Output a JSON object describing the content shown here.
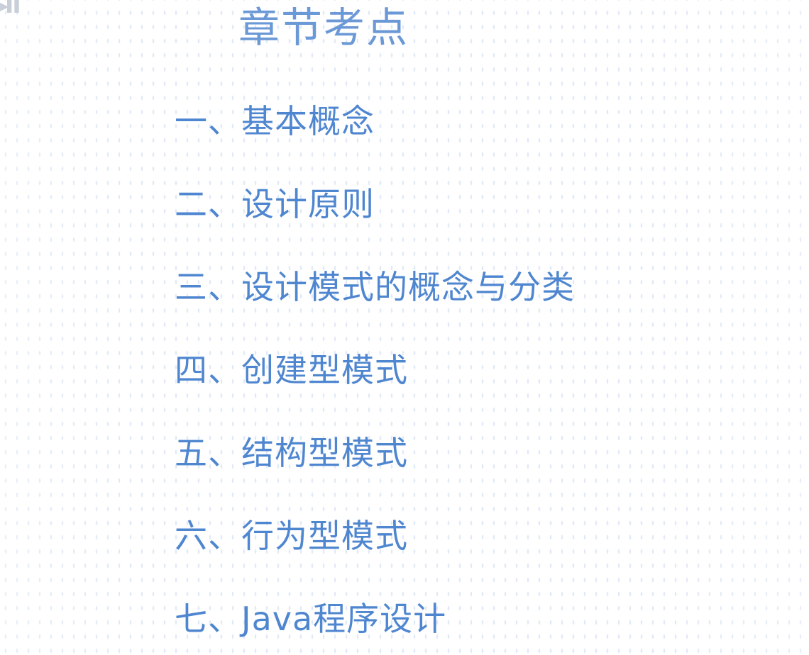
{
  "slide": {
    "title": "章节考点",
    "items": [
      {
        "label": "一、基本概念"
      },
      {
        "label": "二、设计原则"
      },
      {
        "label": "三、设计模式的概念与分类"
      },
      {
        "label": "四、创建型模式"
      },
      {
        "label": "五、结构型模式"
      },
      {
        "label": "六、行为型模式"
      },
      {
        "label": "七、Java程序设计"
      }
    ],
    "colors": {
      "title": "#6b98d6",
      "items": "#4f86d0",
      "background": "#ffffff"
    }
  }
}
